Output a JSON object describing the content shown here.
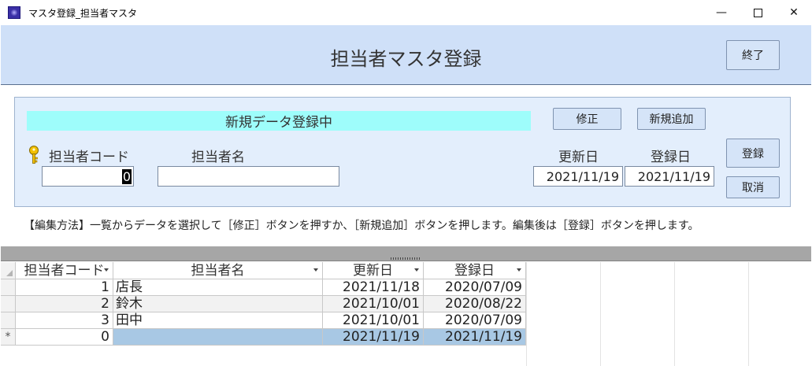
{
  "window": {
    "title": "マスタ登録_担当者マスタ",
    "controls": {
      "minimize": "—",
      "close": "✕"
    }
  },
  "header": {
    "title": "担当者マスタ登録",
    "exit_label": "終了"
  },
  "form": {
    "status_banner": "新規データ登録中",
    "edit_label": "修正",
    "new_label": "新規追加",
    "save_label": "登録",
    "cancel_label": "取消",
    "code_label": "担当者コード",
    "name_label": "担当者名",
    "updated_label": "更新日",
    "registered_label": "登録日",
    "code_value": "0",
    "name_value": "",
    "updated_value": "2021/11/19",
    "registered_value": "2021/11/19",
    "help_text": "【編集方法】一覧からデータを選択して［修正］ボタンを押すか、［新規追加］ボタンを押します。編集後は［登録］ボタンを押します。"
  },
  "datasheet": {
    "columns": [
      "担当者コード",
      "担当者名",
      "更新日",
      "登録日"
    ],
    "rows": [
      {
        "code": "1",
        "name": "店長",
        "updated": "2021/11/18",
        "registered": "2020/07/09"
      },
      {
        "code": "2",
        "name": "鈴木",
        "updated": "2021/10/01",
        "registered": "2020/08/22"
      },
      {
        "code": "3",
        "name": "田中",
        "updated": "2021/10/01",
        "registered": "2020/07/09"
      },
      {
        "code": "0",
        "name": "",
        "updated": "2021/11/19",
        "registered": "2021/11/19",
        "marker": "*"
      }
    ]
  },
  "colors": {
    "header_band": "#cfe0f8",
    "status_banner": "#9efdfb",
    "new_row_highlight": "#a8c8e4",
    "key_icon": "#f2c000"
  }
}
